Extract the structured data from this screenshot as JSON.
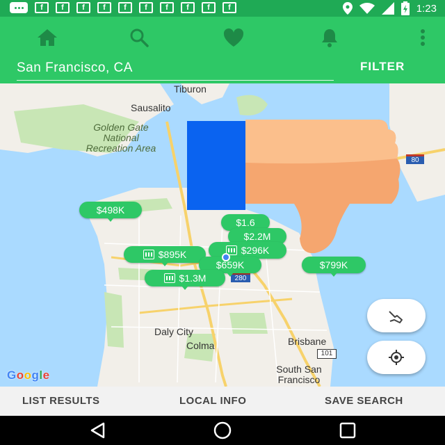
{
  "status_bar": {
    "time": "1:23",
    "notif_glyph": "f",
    "notification_count": 10
  },
  "toolbar": {
    "icons": [
      "home-icon",
      "search-icon",
      "heart-icon",
      "bell-icon",
      "more-vert-icon"
    ],
    "search_value": "San Francisco, CA",
    "filter_label": "FILTER"
  },
  "map": {
    "place_labels": {
      "tiburon": "Tiburon",
      "sausalito": "Sausalito",
      "daly_city": "Daly City",
      "colma": "Colma",
      "brisbane": "Brisbane",
      "south_sf": "South San Francisco"
    },
    "park_label": "Golden Gate National Recreation Area",
    "highway_shields": [
      "80",
      "280",
      "101"
    ],
    "price_pins": [
      "$498K",
      "$1.6",
      "$2.2M",
      "$296K",
      "$895K",
      "$659K",
      "$1.3M",
      "$799K"
    ],
    "google_letters": [
      "G",
      "o",
      "o",
      "g",
      "l",
      "e"
    ],
    "google_colors": [
      "#4285f4",
      "#ea4335",
      "#fbbc05",
      "#4285f4",
      "#34a853",
      "#ea4335"
    ]
  },
  "tabs": {
    "list_results": "LIST RESULTS",
    "local_info": "LOCAL INFO",
    "save_search": "SAVE SEARCH"
  },
  "colors": {
    "brand_green": "#2ec866",
    "status_green": "#1faa55",
    "water": "#aadaff",
    "land": "#f2efe9"
  }
}
